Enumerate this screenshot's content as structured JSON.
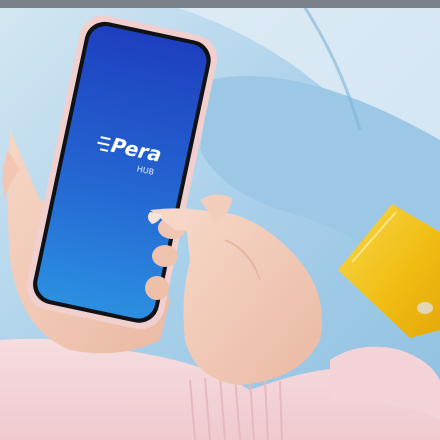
{
  "app_logo": {
    "name": "Pera",
    "subtitle": "HUB"
  },
  "colors": {
    "screen_top": "#1e3fbf",
    "screen_bottom": "#2c8fe0",
    "phone_case": "#f1cfcf",
    "card": "#f2c51c",
    "background_blue": "#a8cfe8",
    "sweater": "#f4d7da",
    "skin": "#f3cbb8"
  }
}
